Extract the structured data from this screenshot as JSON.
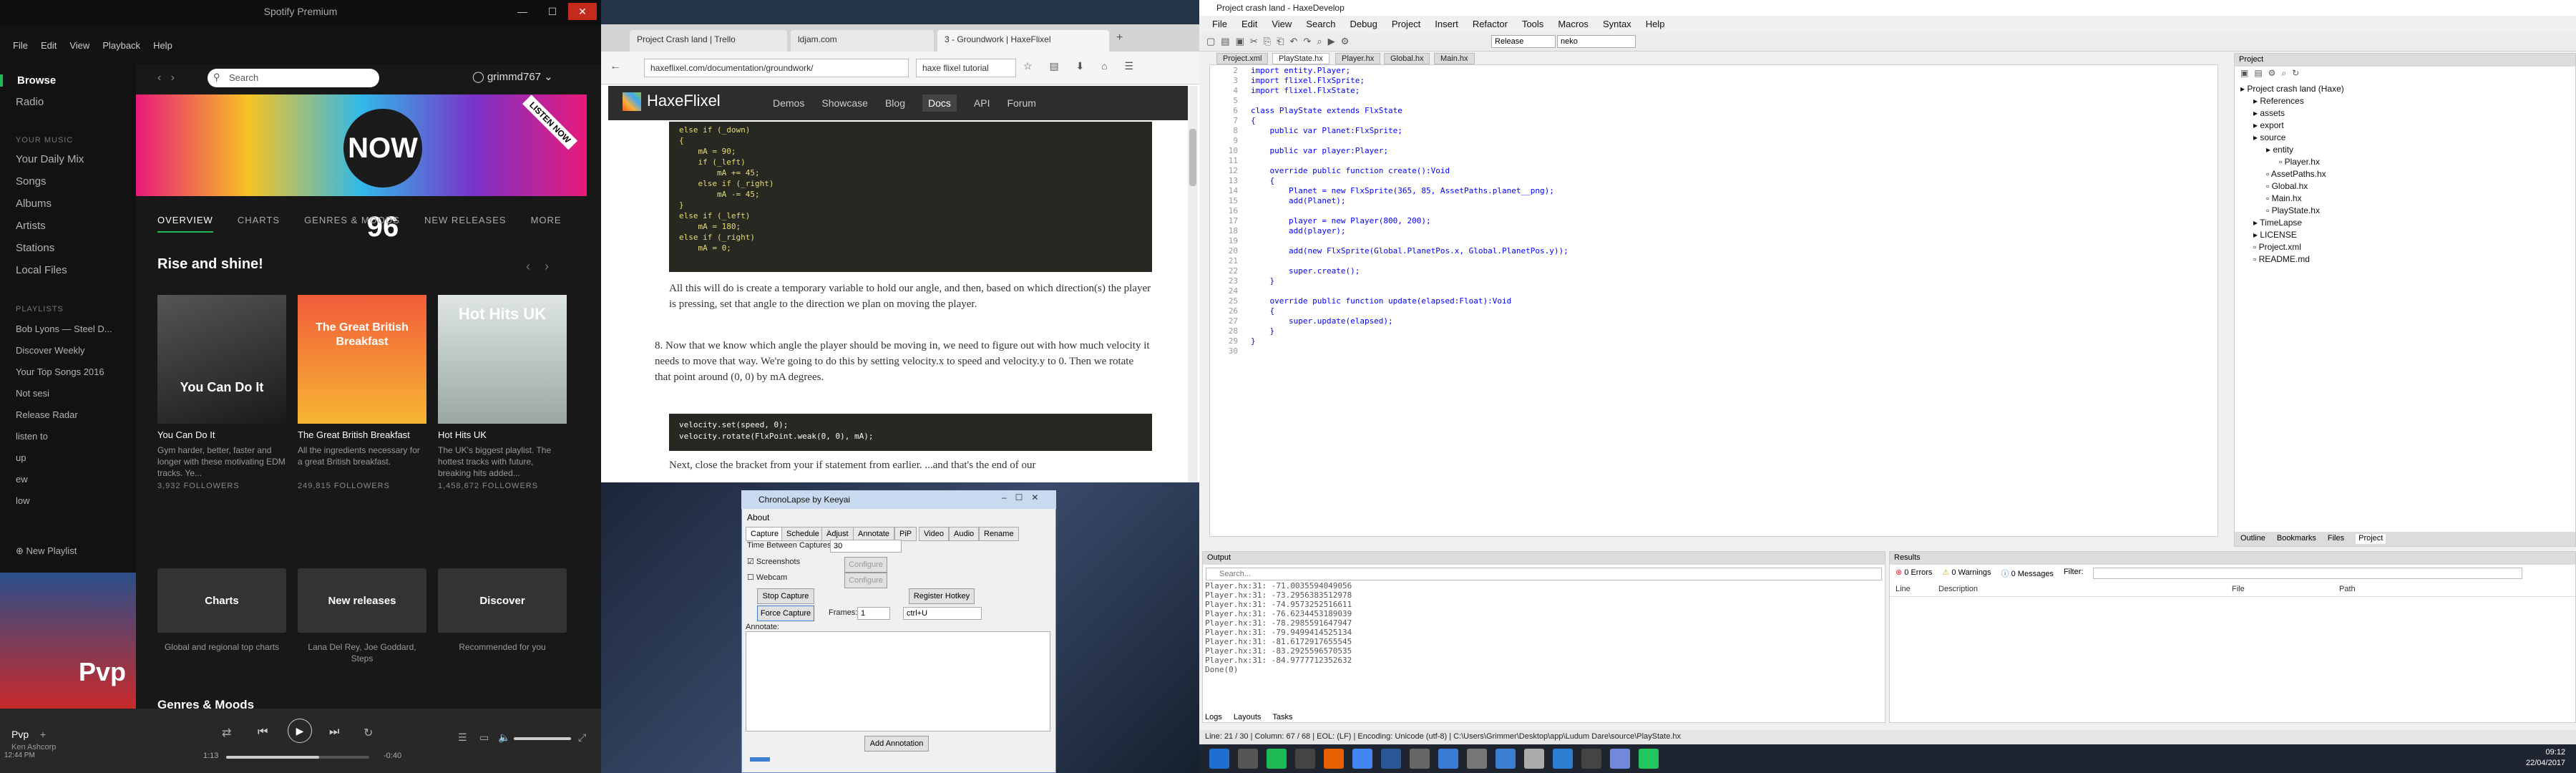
{
  "spotify": {
    "title": "Spotify Premium",
    "menu": [
      "File",
      "Edit",
      "View",
      "Playback",
      "Help"
    ],
    "nav": [
      "Browse",
      "Radio"
    ],
    "your_music_head": "YOUR MUSIC",
    "your_music": [
      "Your Daily Mix",
      "Songs",
      "Albums",
      "Artists",
      "Stations",
      "Local Files"
    ],
    "playlists_head": "PLAYLISTS",
    "playlists": [
      "Bob Lyons — Steel D...",
      "Discover Weekly",
      "Your Top Songs 2016",
      "Not sesi",
      "Release Radar",
      "listen to",
      "up",
      "ew",
      "low"
    ],
    "new_playlist": "New Playlist",
    "search_placeholder": "Search",
    "user": "grimmd767",
    "banner_text": "NOW 96",
    "banner_tag": "LISTEN NOW",
    "tabs": [
      "OVERVIEW",
      "CHARTS",
      "GENRES & MOODS",
      "NEW RELEASES",
      "MORE"
    ],
    "section_title": "Rise and shine!",
    "cards": [
      {
        "img_text": "You Can Do It",
        "title": "You Can Do It",
        "desc": "Gym harder, better, faster and longer with these motivating EDM tracks. Ye...",
        "followers": "3,932 FOLLOWERS"
      },
      {
        "img_text": "The Great British Breakfast",
        "title": "The Great British Breakfast",
        "desc": "All the ingredients necessary for a great British breakfast.",
        "followers": "249,815 FOLLOWERS"
      },
      {
        "img_text": "Hot Hits UK",
        "title": "Hot Hits UK",
        "desc": "The UK's biggest playlist. The hottest tracks with future, breaking hits added...",
        "followers": "1,458,672 FOLLOWERS"
      }
    ],
    "tiles": [
      {
        "label": "Charts",
        "desc": "Global and regional top charts"
      },
      {
        "label": "New releases",
        "desc": "Lana Del Rey, Joe Goddard, Steps"
      },
      {
        "label": "Discover",
        "desc": "Recommended for you"
      }
    ],
    "genres_head": "Genres & Moods",
    "now_playing": {
      "title": "Pvp",
      "artist": "Ken Ashcorp",
      "elapsed": "1:13",
      "total": "-0:40",
      "progress": 0.65
    },
    "corner_time": "12:44 PM"
  },
  "browser": {
    "tabs": [
      "Project Crash land | Trello",
      "ldjam.com",
      "3 - Groundwork | HaxeFlixel"
    ],
    "url": "haxeflixel.com/documentation/groundwork/",
    "search_text": "haxe flixel tutorial",
    "site": {
      "logo": "HaxeFlixel",
      "links": [
        "Demos",
        "Showcase",
        "Blog",
        "Docs",
        "API",
        "Forum"
      ]
    },
    "code1": "else if (_down)\n{\n    mA = 90;\n    if (_left)\n        mA += 45;\n    else if (_right)\n        mA -= 45;\n}\nelse if (_left)\n    mA = 180;\nelse if (_right)\n    mA = 0;",
    "para1": "All this will do is create a temporary variable to hold our angle, and then, based on which direction(s) the player is pressing, set that angle to the direction we plan on moving the player.",
    "para2": "8. Now that we know which angle the player should be moving in, we need to figure out with how much velocity it needs to move that way. We're going to do this by setting velocity.x to speed and velocity.y to 0. Then we rotate that point around (0, 0) by mA degrees.",
    "code2": "velocity.set(speed, 0);\nvelocity.rotate(FlxPoint.weak(0, 0), mA);",
    "para3": "Next, close the bracket from your if statement from earlier. ...and that's the end of our"
  },
  "chronolapse": {
    "title": "ChronoLapse by Keeyai",
    "about": "About",
    "tabs": [
      "Capture",
      "Schedule",
      "Adjust",
      "Annotate",
      "PiP",
      "Video",
      "Audio",
      "Rename"
    ],
    "time_between": "Time Between Captures:",
    "interval": "30",
    "screenshots": "Screenshots",
    "webcam": "Webcam",
    "configure": "Configure",
    "stop_capture": "Stop Capture",
    "register_hotkey": "Register Hotkey",
    "force_capture": "Force Capture",
    "frames_label": "Frames:",
    "frames": "1",
    "hotkey": "ctrl+U",
    "annotate_label": "Annotate:",
    "add_annotation": "Add Annotation"
  },
  "haxedevelop": {
    "title": "Project crash land - HaxeDevelop",
    "menu": [
      "File",
      "Edit",
      "View",
      "Search",
      "Debug",
      "Project",
      "Insert",
      "Refactor",
      "Tools",
      "Macros",
      "Syntax",
      "Help"
    ],
    "build_config": "Release",
    "target": "neko",
    "file_tabs": [
      "Project.xml",
      "PlayState.hx",
      "Player.hx",
      "Global.hx",
      "Main.hx"
    ],
    "line_numbers": "2\n3\n4\n5\n6\n7\n8\n9\n10\n11\n12\n13\n14\n15\n16\n17\n18\n19\n20\n21\n22\n23\n24\n25\n26\n27\n28\n29\n30",
    "code": "import entity.Player;\nimport flixel.FlxSprite;\nimport flixel.FlxState;\n\nclass PlayState extends FlxState\n{\n    public var Planet:FlxSprite;\n\n    public var player:Player;\n\n    override public function create():Void\n    {\n        Planet = new FlxSprite(365, 85, AssetPaths.planet__png);\n        add(Planet);\n\n        player = new Player(800, 200);\n        add(player);\n\n        add(new FlxSprite(Global.PlanetPos.x, Global.PlanetPos.y));\n\n        super.create();\n    }\n\n    override public function update(elapsed:Float):Void\n    {\n        super.update(elapsed);\n    }\n}",
    "project_head": "Project",
    "tree": [
      {
        "label": "Project crash land (Haxe)",
        "depth": 0
      },
      {
        "label": "References",
        "depth": 1
      },
      {
        "label": "assets",
        "depth": 1
      },
      {
        "label": "export",
        "depth": 1
      },
      {
        "label": "source",
        "depth": 1
      },
      {
        "label": "entity",
        "depth": 2
      },
      {
        "label": "Player.hx",
        "depth": 3
      },
      {
        "label": "AssetPaths.hx",
        "depth": 2
      },
      {
        "label": "Global.hx",
        "depth": 2
      },
      {
        "label": "Main.hx",
        "depth": 2
      },
      {
        "label": "PlayState.hx",
        "depth": 2
      },
      {
        "label": "TimeLapse",
        "depth": 1
      },
      {
        "label": "LICENSE",
        "depth": 1
      },
      {
        "label": "Project.xml",
        "depth": 1
      },
      {
        "label": "README.md",
        "depth": 1
      }
    ],
    "side_tabs": [
      "Outline",
      "Bookmarks",
      "Files",
      "Project"
    ],
    "output_head": "Output",
    "output_search": "Search...",
    "output_lines": "Player.hx:31: -71.0035594049056\nPlayer.hx:31: -73.2956383512978\nPlayer.hx:31: -74.9573252516611\nPlayer.hx:31: -76.6234453189039\nPlayer.hx:31: -78.2985591647947\nPlayer.hx:31: -79.9499414525134\nPlayer.hx:31: -81.6172917655545\nPlayer.hx:31: -83.2925596570535\nPlayer.hx:31: -84.9777712352632\nDone(0)",
    "results_head": "Results",
    "errors": "0 Errors",
    "warnings": "0 Warnings",
    "messages": "0 Messages",
    "filter": "Filter:",
    "cols": [
      "Line",
      "Description",
      "File",
      "Path"
    ],
    "bottom_tabs": [
      "Logs",
      "Layouts",
      "Tasks"
    ],
    "status": "Line: 21 / 30  |  Column: 67 / 68  |  EOL: (LF)  |  Encoding: Unicode (utf-8)  |  C:\\Users\\Grimmer\\Desktop\\app\\Ludum Dare\\source\\PlayState.hx"
  },
  "taskbar": {
    "time": "09:12",
    "date": "22/04/2017"
  }
}
